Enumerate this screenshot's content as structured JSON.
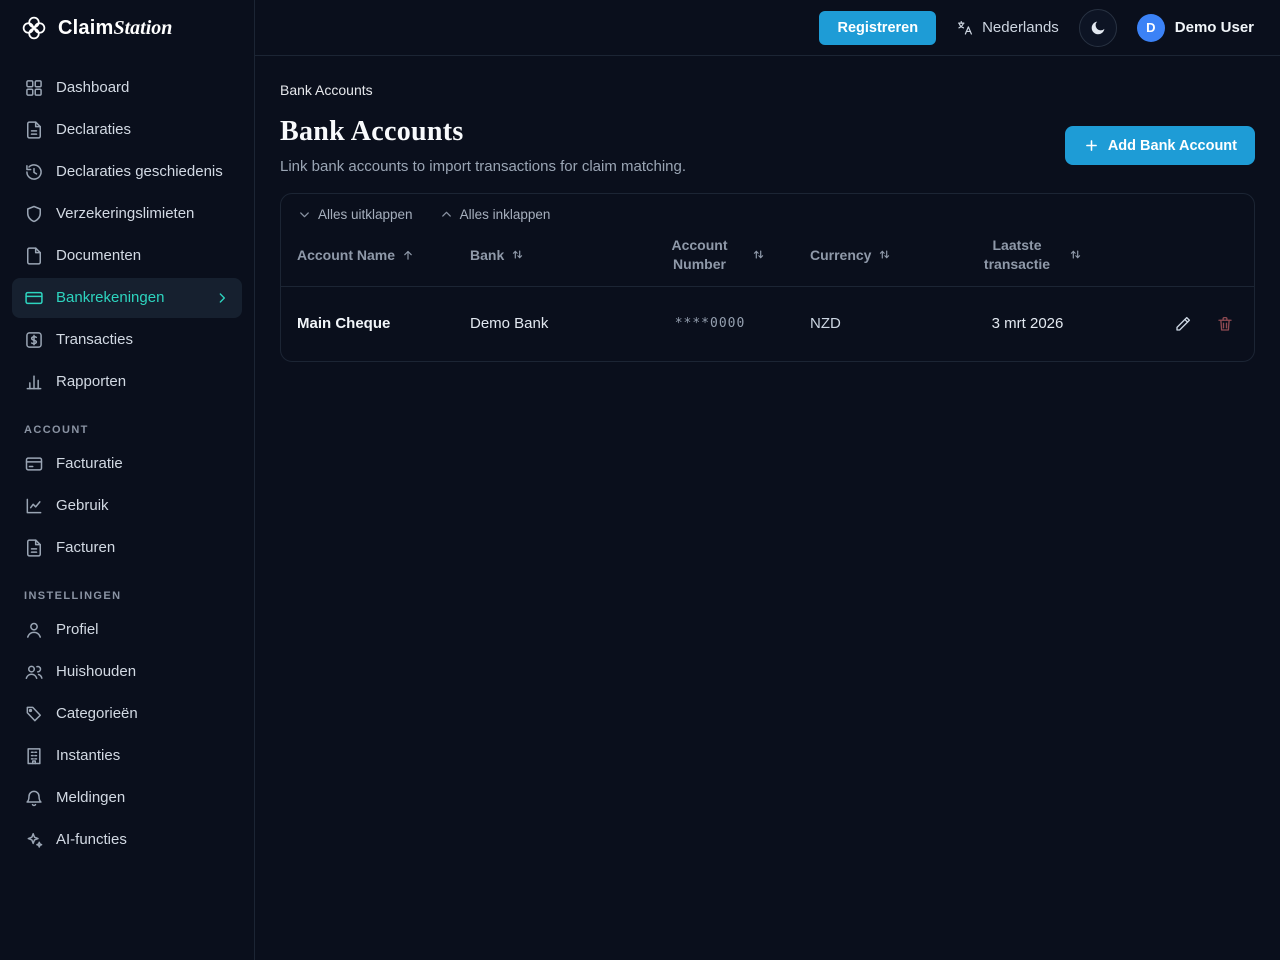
{
  "colors": {
    "accent": "#1e9cd6",
    "active_teal": "#2dd4bf",
    "danger": "#8f4a52",
    "avatar_blue": "#3b82f6",
    "background": "#0a0f1c",
    "border": "#1c2534"
  },
  "header": {
    "brand_first": "Claim",
    "brand_second": "Station",
    "register_label": "Registreren",
    "language_label": "Nederlands",
    "user_initial": "D",
    "user_name": "Demo User"
  },
  "sidebar": {
    "nav": [
      {
        "label": "Dashboard",
        "icon": "dashboard-icon"
      },
      {
        "label": "Declaraties",
        "icon": "document-icon"
      },
      {
        "label": "Declaraties geschiedenis",
        "icon": "history-icon"
      },
      {
        "label": "Verzekeringslimieten",
        "icon": "shield-icon"
      },
      {
        "label": "Documenten",
        "icon": "file-icon"
      },
      {
        "label": "Bankrekeningen",
        "icon": "credit-card-icon",
        "active": true
      },
      {
        "label": "Transacties",
        "icon": "dollar-icon"
      },
      {
        "label": "Rapporten",
        "icon": "bar-chart-icon"
      }
    ],
    "account_section": "ACCOUNT",
    "account_items": [
      {
        "label": "Facturatie",
        "icon": "billing-card-icon"
      },
      {
        "label": "Gebruik",
        "icon": "usage-chart-icon"
      },
      {
        "label": "Facturen",
        "icon": "invoice-icon"
      }
    ],
    "settings_section": "INSTELLINGEN",
    "settings_items": [
      {
        "label": "Profiel",
        "icon": "user-icon"
      },
      {
        "label": "Huishouden",
        "icon": "users-icon"
      },
      {
        "label": "Categorieën",
        "icon": "tag-icon"
      },
      {
        "label": "Instanties",
        "icon": "building-icon"
      },
      {
        "label": "Meldingen",
        "icon": "bell-icon"
      },
      {
        "label": "AI-functies",
        "icon": "sparkles-icon"
      }
    ]
  },
  "main": {
    "breadcrumb": "Bank Accounts",
    "title": "Bank Accounts",
    "subtitle": "Link bank accounts to import transactions for claim matching.",
    "add_button": "Add Bank Account",
    "expand_all": "Alles uitklappen",
    "collapse_all": "Alles inklappen",
    "table": {
      "columns": [
        "Account Name",
        "Bank",
        "Account Number",
        "Currency",
        "Laatste transactie"
      ],
      "rows": [
        {
          "account_name": "Main Cheque",
          "bank": "Demo Bank",
          "account_number": "****0000",
          "currency": "NZD",
          "last_transaction": "3 mrt 2026"
        }
      ]
    }
  }
}
